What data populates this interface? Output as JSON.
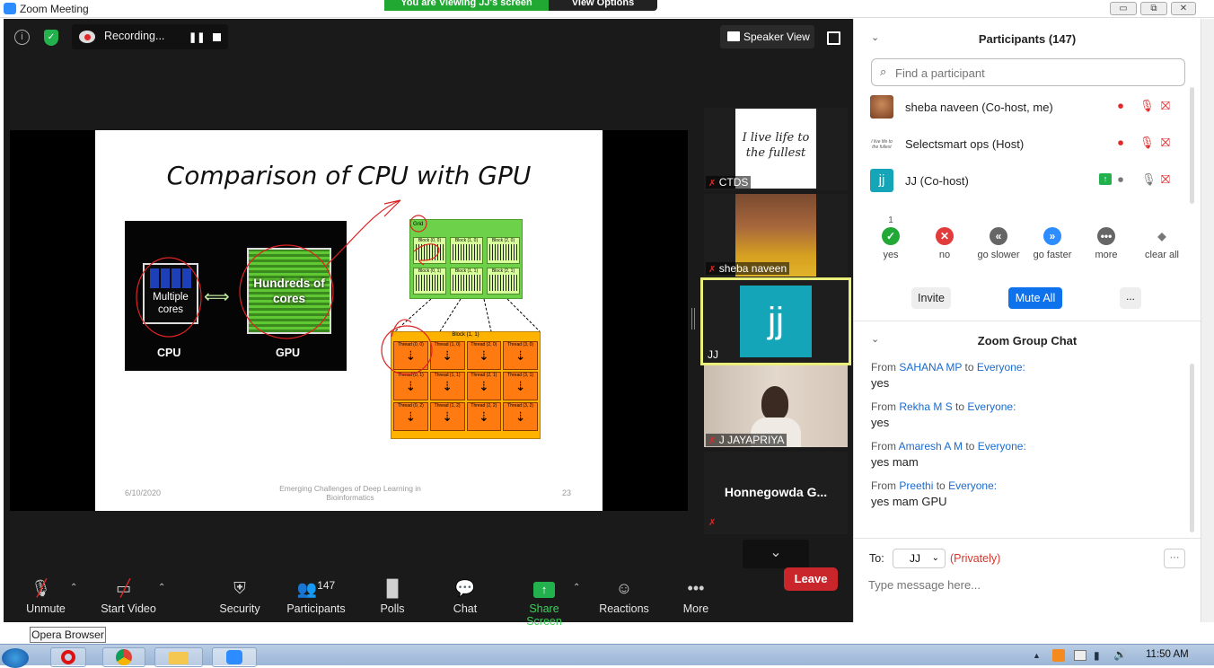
{
  "window": {
    "title": "Zoom Meeting",
    "minimize": "▭",
    "maximize": "⧉",
    "close": "✕"
  },
  "share_banner": {
    "viewing": "You are Viewing JJ's screen",
    "view_options": "View Options"
  },
  "topbar": {
    "recording": "Recording...",
    "speaker_view": "Speaker View"
  },
  "slide": {
    "title": "Comparison of CPU with GPU",
    "cpu_box": "Multiple cores",
    "gpu_box": "Hundreds of cores",
    "cpu_label": "CPU",
    "gpu_label": "GPU",
    "grid_label": "Grid",
    "blocks": [
      "Block (0, 0)",
      "Block (1, 0)",
      "Block (2, 0)",
      "Block (0, 1)",
      "Block (1, 1)",
      "Block (2, 1)"
    ],
    "block_title": "Block (1, 1)",
    "threads": [
      "Thread (0, 0)",
      "Thread (1, 0)",
      "Thread (2, 0)",
      "Thread (3, 0)",
      "Thread (0, 1)",
      "Thread (1, 1)",
      "Thread (2, 1)",
      "Thread (3, 1)",
      "Thread (0, 2)",
      "Thread (1, 2)",
      "Thread (2, 2)",
      "Thread (3, 2)"
    ],
    "date": "6/10/2020",
    "footer": "Emerging Challenges of Deep Learning in Bioinformatics",
    "page": "23"
  },
  "thumbnails": [
    {
      "name": "CTDS",
      "image_text": "I live life to the fullest"
    },
    {
      "name": "sheba naveen"
    },
    {
      "name": "JJ",
      "avatar": "jj"
    },
    {
      "name": "J JAYAPRIYA"
    },
    {
      "name": "Honnegowda  G..."
    }
  ],
  "toolbar": {
    "unmute": "Unmute",
    "start_video": "Start Video",
    "security": "Security",
    "participants": "Participants",
    "participants_count": "147",
    "polls": "Polls",
    "chat": "Chat",
    "share_screen": "Share Screen",
    "reactions": "Reactions",
    "more": "More",
    "leave": "Leave"
  },
  "participants_panel": {
    "title": "Participants (147)",
    "search_placeholder": "Find a participant",
    "list": [
      {
        "name": "sheba naveen (Co-host, me)"
      },
      {
        "name": "Selectsmart ops (Host)"
      },
      {
        "name": "JJ (Co-host)",
        "avatar": "jj"
      }
    ],
    "reactions": [
      {
        "label": "yes",
        "count": "1",
        "glyph": "✓",
        "color": "#21a836"
      },
      {
        "label": "no",
        "count": "",
        "glyph": "✕",
        "color": "#e23b3b"
      },
      {
        "label": "go slower",
        "count": "",
        "glyph": "«",
        "color": "#666666"
      },
      {
        "label": "go faster",
        "count": "",
        "glyph": "»",
        "color": "#2d8cff"
      },
      {
        "label": "more",
        "count": "",
        "glyph": "•••",
        "color": "#666666"
      },
      {
        "label": "clear all",
        "count": "",
        "glyph": "◆",
        "color": "#777777"
      }
    ],
    "invite": "Invite",
    "mute_all": "Mute All",
    "ellipsis": "..."
  },
  "chat_panel": {
    "title": "Zoom Group Chat",
    "messages": [
      {
        "from_prefix": "From",
        "sender": "SAHANA MP",
        "to": "to",
        "recipient": "Everyone:",
        "text": "yes"
      },
      {
        "from_prefix": "From",
        "sender": "Rekha M S",
        "to": "to",
        "recipient": "Everyone:",
        "text": "yes"
      },
      {
        "from_prefix": "From",
        "sender": "Amaresh A M",
        "to": "to",
        "recipient": "Everyone:",
        "text": "yes mam"
      },
      {
        "from_prefix": "From",
        "sender": "Preethi",
        "to": "to",
        "recipient": "Everyone:",
        "text": "yes mam GPU"
      }
    ],
    "to_label": "To:",
    "to_value": "JJ",
    "privately": "(Privately)",
    "input_placeholder": "Type message here...",
    "more": "···"
  },
  "taskbar": {
    "tooltip": "Opera Browser",
    "clock": "11:50 AM"
  }
}
